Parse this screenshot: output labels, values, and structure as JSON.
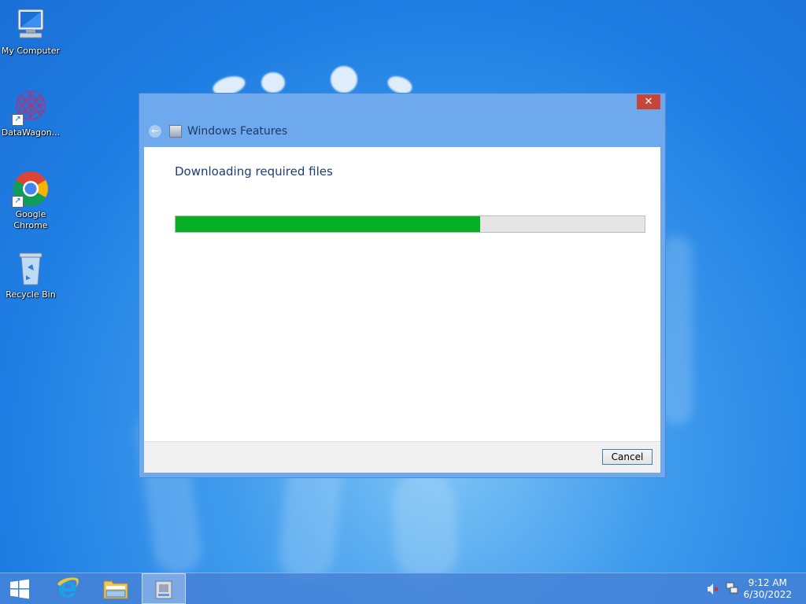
{
  "desktop": {
    "icons": [
      {
        "label": "My Computer",
        "icon": "computer-icon"
      },
      {
        "label": "DataWagon...",
        "icon": "datawagon-icon",
        "shortcut": true
      },
      {
        "label": "Google\nChrome",
        "icon": "chrome-icon",
        "shortcut": true
      },
      {
        "label": "Recycle Bin",
        "icon": "recycle-bin-icon"
      }
    ]
  },
  "dialog": {
    "title": "Windows Features",
    "close_label": "✕",
    "back_label": "←",
    "heading": "Downloading required files",
    "progress_percent": 65,
    "cancel_label": "Cancel"
  },
  "taskbar": {
    "items": [
      "start-button",
      "internet-explorer",
      "file-explorer",
      "windows-features"
    ],
    "active_item": "windows-features",
    "tray": {
      "time": "9:12 AM",
      "date": "6/30/2022",
      "icons": [
        "speaker-muted-icon",
        "network-icon"
      ]
    }
  },
  "colors": {
    "desktop_blue": "#1f7ee3",
    "dialog_frame": "#6ea9ee",
    "progress_green": "#06b025",
    "close_red": "#c7463c"
  }
}
